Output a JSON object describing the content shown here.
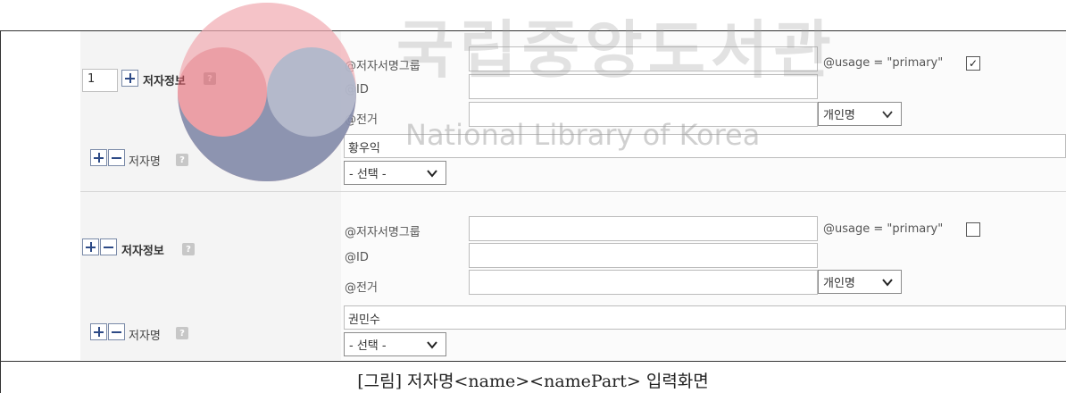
{
  "author_block_1": {
    "count_value": "1",
    "label": "저자정보",
    "attrs": {
      "name_group_label": "@저자서명그룹",
      "id_label": "@ID",
      "authority_label": "@전거",
      "usage_label": "@usage = \"primary\"",
      "usage_checked": true,
      "authority_select": "개인명"
    },
    "name_row": {
      "label": "저자명",
      "name_value": "황우익",
      "select_value": "- 선택 -"
    }
  },
  "author_block_2": {
    "label": "저자정보",
    "attrs": {
      "name_group_label": "@저자서명그룹",
      "id_label": "@ID",
      "authority_label": "@전거",
      "usage_label": "@usage = \"primary\"",
      "usage_checked": false,
      "authority_select": "개인명"
    },
    "name_row": {
      "label": "저자명",
      "name_value": "권민수",
      "select_value": "- 선택 -"
    }
  },
  "icons": {
    "plus": "plus-icon",
    "minus": "minus-icon",
    "help": "help-icon",
    "chevron": "chevron-down-icon",
    "check": "checkmark-icon"
  },
  "help_glyph": "?",
  "check_glyph": "✓",
  "caption": "[그림] 저자명<name><namePart> 입력화면",
  "watermark": {
    "text": "국립중앙도서관",
    "subtext": "National Library of Korea"
  },
  "colors": {
    "button_accent": "#2d4a86",
    "logo_red": "#e45a66",
    "logo_blue": "#7d92b2"
  }
}
